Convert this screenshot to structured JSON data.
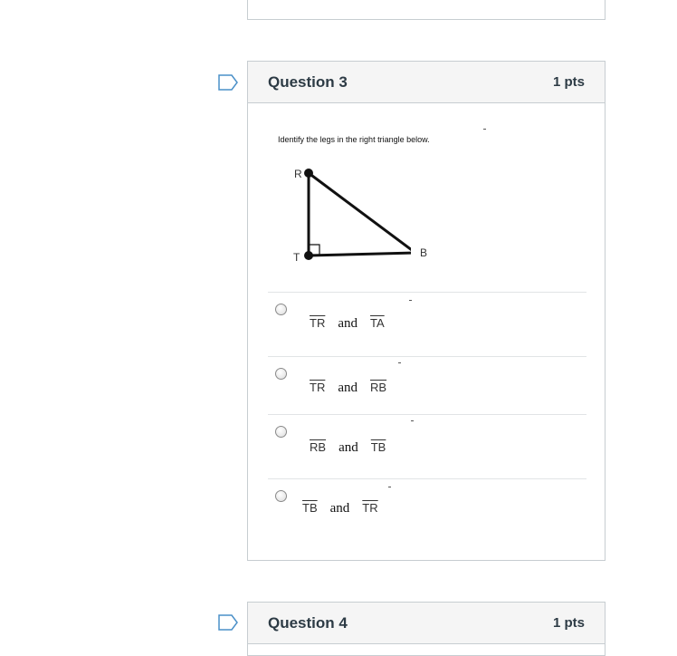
{
  "question3": {
    "title": "Question 3",
    "points": "1 pts",
    "prompt": "Identify the legs in the right triangle below.",
    "figure": {
      "vertex_R": "R",
      "vertex_T": "T",
      "vertex_B": "B"
    },
    "options": [
      {
        "seg1": "TR",
        "conj": "and",
        "seg2": "TA"
      },
      {
        "seg1": "TR",
        "conj": "and",
        "seg2": "RB"
      },
      {
        "seg1": "RB",
        "conj": "and",
        "seg2": "TB"
      },
      {
        "seg1": "TB",
        "conj": "and",
        "seg2": "TR"
      }
    ]
  },
  "question4": {
    "title": "Question 4",
    "points": "1 pts"
  },
  "colors": {
    "border": "#c7cdd1",
    "header_bg": "#f5f5f5",
    "flag": "#4a90c8",
    "text": "#2d3b45"
  },
  "icons": {
    "flag": "bookmark-flag-icon",
    "radio": "radio-button"
  }
}
